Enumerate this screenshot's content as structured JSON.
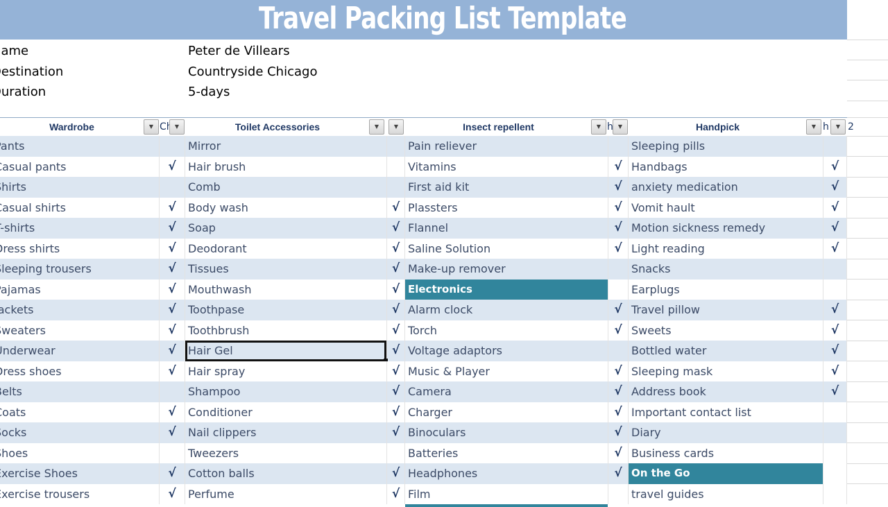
{
  "title": "Travel Packing List Template",
  "info": [
    {
      "label": "Name",
      "value": "Peter de Villears"
    },
    {
      "label": "Destination",
      "value": "Countryside Chicago"
    },
    {
      "label": "Duration",
      "value": "5-days"
    }
  ],
  "columns": [
    {
      "header": "Wardrobe",
      "check_header": "Ch"
    },
    {
      "header": "Toilet Accessories",
      "check_header": ""
    },
    {
      "header": "Insect repellent",
      "check_header": "h"
    },
    {
      "header": "Handpick",
      "check_header": "h"
    }
  ],
  "extra_header": "2",
  "check_glyph": "√",
  "rows": [
    [
      {
        "t": "Pants",
        "c": false
      },
      {
        "t": "Mirror",
        "c": false
      },
      {
        "t": "Pain reliever",
        "c": false
      },
      {
        "t": "Sleeping pills",
        "c": false
      }
    ],
    [
      {
        "t": "Casual pants",
        "c": true
      },
      {
        "t": "Hair brush",
        "c": false
      },
      {
        "t": "Vitamins",
        "c": true
      },
      {
        "t": "Handbags",
        "c": true
      }
    ],
    [
      {
        "t": "Shirts",
        "c": false
      },
      {
        "t": "Comb",
        "c": false
      },
      {
        "t": "First aid kit",
        "c": true
      },
      {
        "t": "anxiety medication",
        "c": true
      }
    ],
    [
      {
        "t": "Casual shirts",
        "c": true
      },
      {
        "t": "Body wash",
        "c": true
      },
      {
        "t": "Plassters",
        "c": true
      },
      {
        "t": "Vomit hault",
        "c": true
      }
    ],
    [
      {
        "t": "T-shirts",
        "c": true
      },
      {
        "t": "Soap",
        "c": true
      },
      {
        "t": "Flannel",
        "c": true
      },
      {
        "t": "Motion sickness remedy",
        "c": true
      }
    ],
    [
      {
        "t": "Dress shirts",
        "c": true
      },
      {
        "t": "Deodorant",
        "c": true
      },
      {
        "t": "Saline Solution",
        "c": true
      },
      {
        "t": "Light reading",
        "c": true
      }
    ],
    [
      {
        "t": "Sleeping trousers",
        "c": true
      },
      {
        "t": "Tissues",
        "c": true
      },
      {
        "t": "Make-up remover",
        "c": false
      },
      {
        "t": "Snacks",
        "c": false
      }
    ],
    [
      {
        "t": "Pajamas",
        "c": true
      },
      {
        "t": "Mouthwash",
        "c": true
      },
      {
        "t": "Electronics",
        "c": false,
        "section": true
      },
      {
        "t": "Earplugs",
        "c": false
      }
    ],
    [
      {
        "t": "Jackets",
        "c": true
      },
      {
        "t": "Toothpase",
        "c": true
      },
      {
        "t": "Alarm clock",
        "c": true
      },
      {
        "t": "Travel pillow",
        "c": true
      }
    ],
    [
      {
        "t": "Sweaters",
        "c": true
      },
      {
        "t": "Toothbrush",
        "c": true
      },
      {
        "t": "Torch",
        "c": true
      },
      {
        "t": "Sweets",
        "c": true
      }
    ],
    [
      {
        "t": "Underwear",
        "c": true
      },
      {
        "t": "Hair Gel",
        "c": true,
        "selected": true
      },
      {
        "t": "Voltage adaptors",
        "c": false
      },
      {
        "t": "Bottled water",
        "c": true
      }
    ],
    [
      {
        "t": "Dress shoes",
        "c": true
      },
      {
        "t": "Hair spray",
        "c": true
      },
      {
        "t": "Music & Player",
        "c": true
      },
      {
        "t": "Sleeping mask",
        "c": true
      }
    ],
    [
      {
        "t": "Belts",
        "c": false
      },
      {
        "t": "Shampoo",
        "c": true
      },
      {
        "t": "Camera",
        "c": true
      },
      {
        "t": "Address book",
        "c": true
      }
    ],
    [
      {
        "t": "Coats",
        "c": true
      },
      {
        "t": "Conditioner",
        "c": true
      },
      {
        "t": "Charger",
        "c": true
      },
      {
        "t": "Important contact list",
        "c": false
      }
    ],
    [
      {
        "t": "Socks",
        "c": true
      },
      {
        "t": "Nail clippers",
        "c": true
      },
      {
        "t": "Binoculars",
        "c": true
      },
      {
        "t": "Diary",
        "c": false
      }
    ],
    [
      {
        "t": "Shoes",
        "c": false
      },
      {
        "t": "Tweezers",
        "c": false
      },
      {
        "t": "Batteries",
        "c": true
      },
      {
        "t": "Business cards",
        "c": false
      }
    ],
    [
      {
        "t": "Exercise Shoes",
        "c": true
      },
      {
        "t": "Cotton balls",
        "c": true
      },
      {
        "t": "Headphones",
        "c": true
      },
      {
        "t": "On the Go",
        "c": false,
        "section": true
      }
    ],
    [
      {
        "t": "Exercise trousers",
        "c": true
      },
      {
        "t": "Perfume",
        "c": true
      },
      {
        "t": "Film",
        "c": false
      },
      {
        "t": "travel guides",
        "c": false
      }
    ]
  ],
  "colors": {
    "title_bg": "#95b3d7",
    "band": "#dce6f1",
    "section": "#31859c",
    "text": "#3b4a66",
    "header_text": "#1f3864"
  }
}
